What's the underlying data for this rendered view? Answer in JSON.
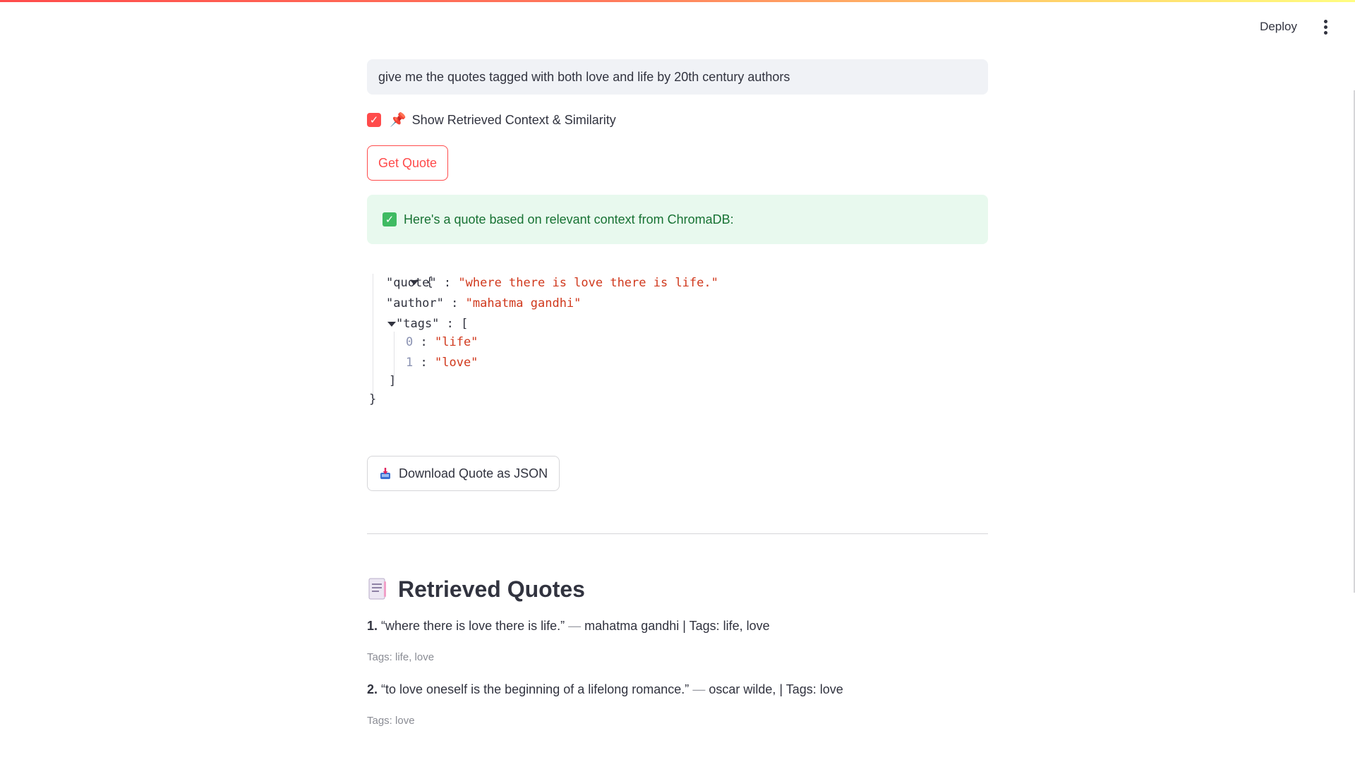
{
  "header": {
    "deploy_label": "Deploy",
    "menu_icon": "kebab-menu-icon"
  },
  "query": {
    "value": "give me the quotes tagged with both love and life by 20th century authors"
  },
  "context_toggle": {
    "checked": true,
    "icon": "pushpin-icon",
    "label": "Show Retrieved Context & Similarity"
  },
  "get_quote": {
    "label": "Get Quote"
  },
  "success": {
    "icon": "check-mark-icon",
    "message": "Here's a quote based on relevant context from ChromaDB:"
  },
  "json_result": {
    "open_brace": "{",
    "close_brace": "}",
    "quote_key": "\"quote\"",
    "quote_value": "\"where there is love there is life.\"",
    "author_key": "\"author\"",
    "author_value": "\"mahatma gandhi\"",
    "tags_key": "\"tags\"",
    "tags_open": "[",
    "tags_close": "]",
    "sep": ":",
    "tags": [
      {
        "index": "0",
        "value": "\"life\""
      },
      {
        "index": "1",
        "value": "\"love\""
      }
    ]
  },
  "download": {
    "icon": "inbox-tray-icon",
    "label": "Download Quote as JSON"
  },
  "retrieved": {
    "icon": "page-icon",
    "title": "Retrieved Quotes",
    "items": [
      {
        "num": "1.",
        "quote": "“where there is love there is life.”",
        "dash": "—",
        "rest": "mahatma gandhi | Tags: life, love",
        "tags_caption": "Tags: life, love"
      },
      {
        "num": "2.",
        "quote": "“to love oneself is the beginning of a lifelong romance.”",
        "dash": "—",
        "rest": "oscar wilde, | Tags: love",
        "tags_caption": "Tags: love"
      }
    ]
  },
  "colors": {
    "accent": "#ff4b4b",
    "success_bg": "#e8f9ee",
    "success_text": "#177233",
    "json_string": "#d0381c",
    "json_index": "#8a92b2"
  }
}
